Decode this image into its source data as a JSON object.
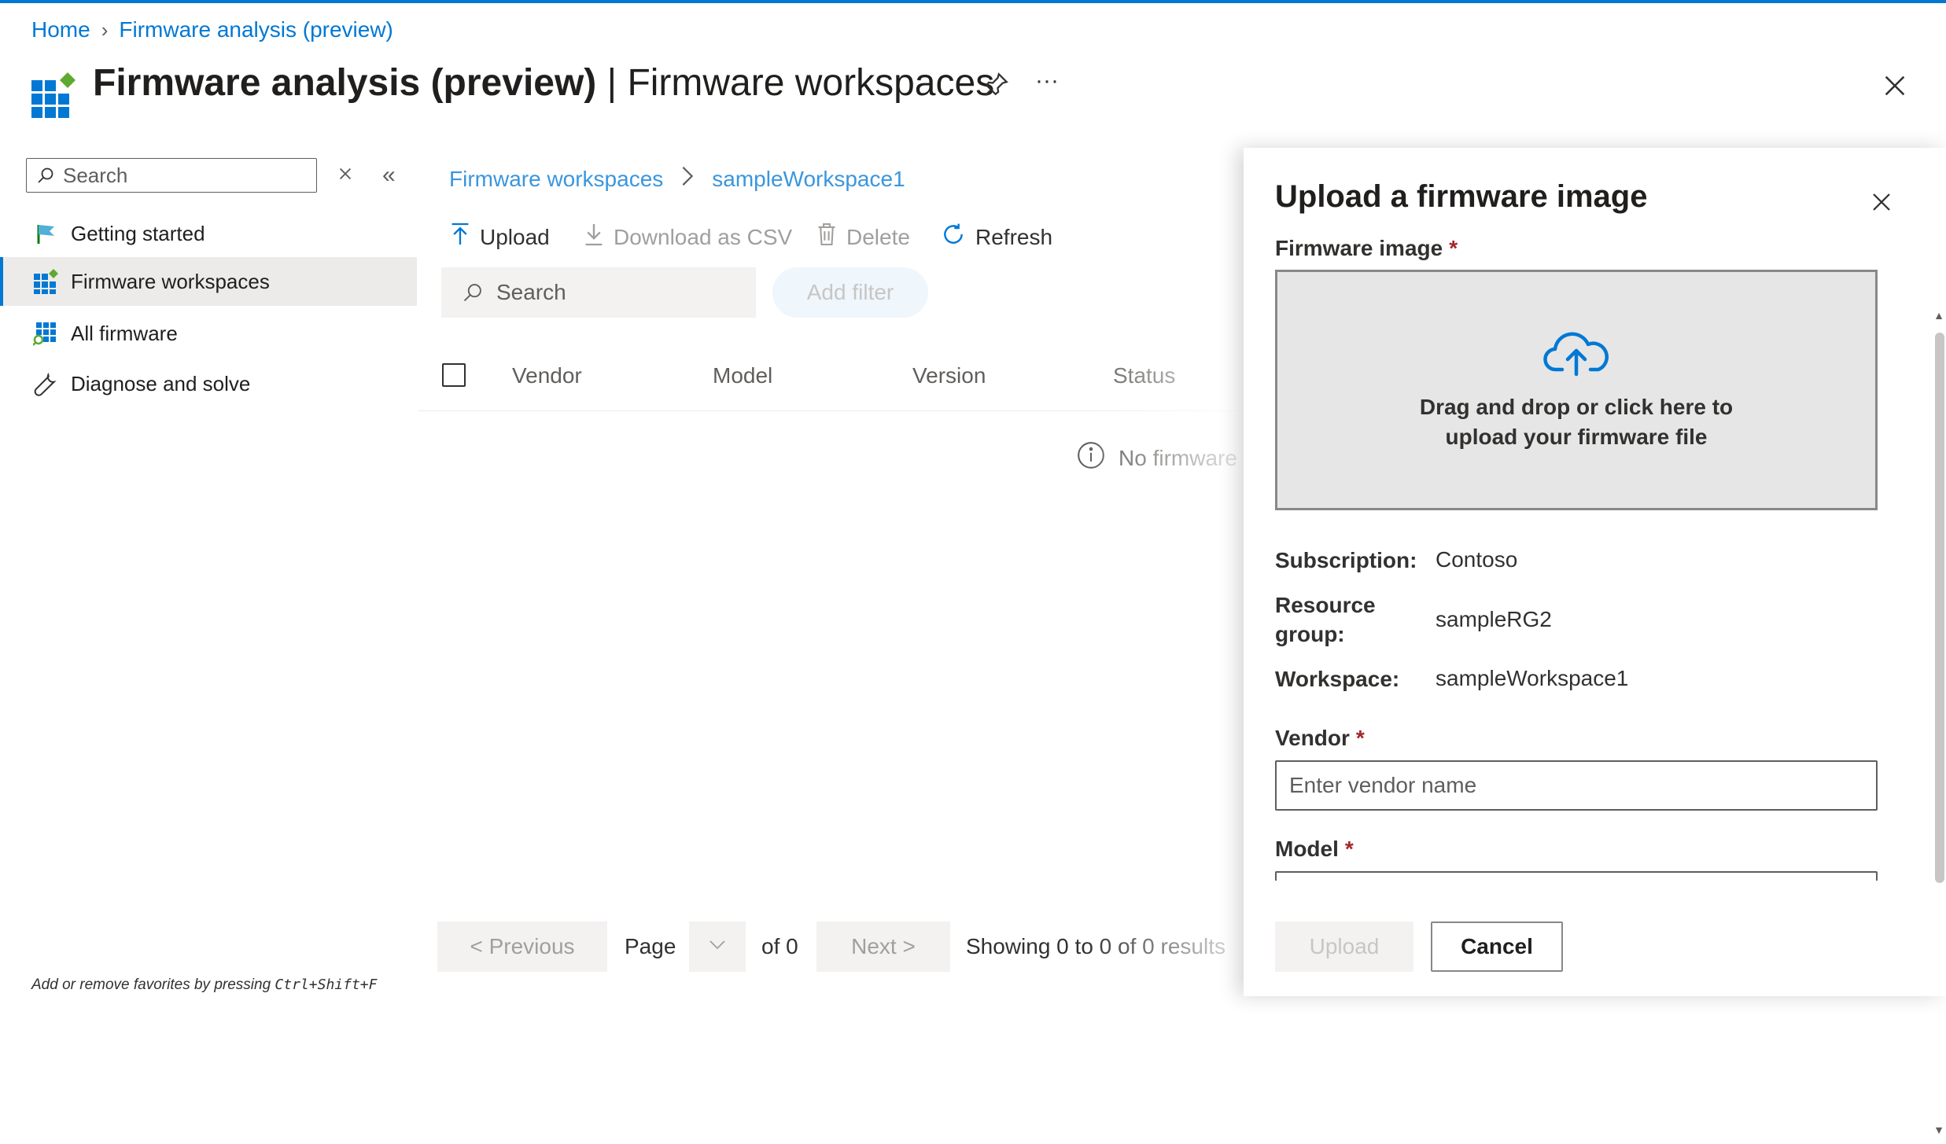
{
  "breadcrumb": {
    "home": "Home",
    "current": "Firmware analysis (preview)"
  },
  "header": {
    "title_bold": "Firmware analysis (preview)",
    "title_sep": " | ",
    "title_rest": "Firmware workspaces",
    "more": "···"
  },
  "sidebar": {
    "search_placeholder": "Search",
    "items": [
      {
        "label": "Getting started"
      },
      {
        "label": "Firmware workspaces"
      },
      {
        "label": "All firmware"
      },
      {
        "label": "Diagnose and solve"
      }
    ],
    "footnote_text": "Add or remove favorites by pressing ",
    "footnote_keys": "Ctrl+Shift+F"
  },
  "main": {
    "breadcrumb": {
      "parent": "Firmware workspaces",
      "current": "sampleWorkspace1"
    },
    "toolbar": {
      "upload": "Upload",
      "download": "Download as CSV",
      "delete": "Delete",
      "refresh": "Refresh"
    },
    "search_placeholder": "Search",
    "add_filter": "Add filter",
    "columns": [
      "Vendor",
      "Model",
      "Version",
      "Status"
    ],
    "empty_message": "No firmware",
    "pager": {
      "previous": "< Previous",
      "page_label": "Page",
      "of_label": "of 0",
      "next": "Next >",
      "showing": "Showing 0 to 0 of 0 results"
    }
  },
  "panel": {
    "title": "Upload a firmware image",
    "firmware_image_label": "Firmware image",
    "required_mark": "*",
    "dropzone_line1": "Drag and drop or click here to",
    "dropzone_line2": "upload your firmware file",
    "subscription_label": "Subscription:",
    "subscription_value": "Contoso",
    "resource_group_label_1": "Resource",
    "resource_group_label_2": "group:",
    "resource_group_value": "sampleRG2",
    "workspace_label": "Workspace:",
    "workspace_value": "sampleWorkspace1",
    "vendor_label": "Vendor",
    "vendor_placeholder": "Enter vendor name",
    "model_label": "Model",
    "upload_button": "Upload",
    "cancel_button": "Cancel"
  },
  "colors": {
    "accent": "#0078d4",
    "required": "#a4262c",
    "selected_bg": "#edebe9"
  }
}
